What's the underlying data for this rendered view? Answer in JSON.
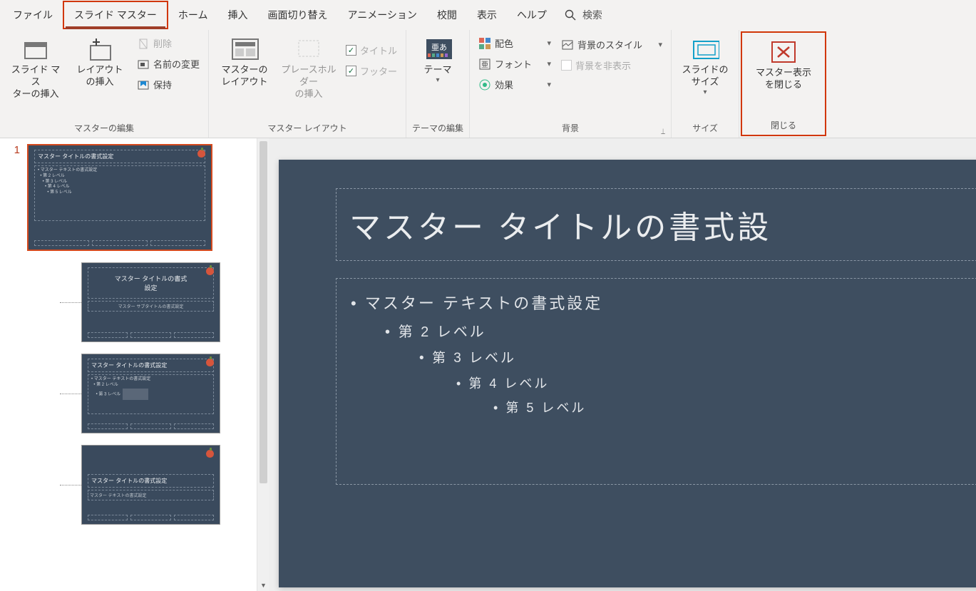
{
  "tabs": {
    "file": "ファイル",
    "slide_master": "スライド マスター",
    "home": "ホーム",
    "insert": "挿入",
    "transitions": "画面切り替え",
    "animations": "アニメーション",
    "review": "校閲",
    "view": "表示",
    "help": "ヘルプ",
    "search": "検索"
  },
  "ribbon": {
    "master_edit": {
      "insert_slide_master": "スライド マス\nターの挿入",
      "insert_layout": "レイアウト\nの挿入",
      "delete": "削除",
      "rename": "名前の変更",
      "preserve": "保持",
      "group_label": "マスターの編集"
    },
    "master_layout": {
      "master_layout": "マスターの\nレイアウト",
      "insert_placeholder": "プレースホルダー\nの挿入",
      "title_cb": "タイトル",
      "footer_cb": "フッター",
      "group_label": "マスター レイアウト"
    },
    "theme_edit": {
      "themes": "テーマ",
      "group_label": "テーマの編集"
    },
    "background": {
      "colors": "配色",
      "fonts": "フォント",
      "effects": "効果",
      "bg_styles": "背景のスタイル",
      "hide_bg": "背景を非表示",
      "group_label": "背景"
    },
    "size": {
      "slide_size": "スライドの\nサイズ",
      "group_label": "サイズ"
    },
    "close": {
      "close_master": "マスター表示\nを閉じる",
      "group_label": "閉じる"
    }
  },
  "sidebar": {
    "slide_number": "1",
    "master_thumb": {
      "title": "マスター タイトルの書式設定",
      "body_l1": "マスター テキストの書式設定",
      "body_l2": "第 2 レベル",
      "body_l3": "第 3 レベル",
      "body_l4": "第 4 レベル",
      "body_l5": "第 5 レベル"
    },
    "layout1": {
      "title": "マスター タイトルの書式\n設定",
      "subtitle": "マスター サブタイトルの書式設定"
    },
    "layout2": {
      "title": "マスター タイトルの書式設定",
      "body": "マスター テキストの書式設定"
    },
    "layout3": {
      "title": "マスター タイトルの書式設定",
      "body": "マスター テキストの書式設定"
    }
  },
  "slide": {
    "title": "マスター タイトルの書式設",
    "body": {
      "l1": "マスター テキストの書式設定",
      "l2": "第 2 レベル",
      "l3": "第 3 レベル",
      "l4": "第 4 レベル",
      "l5": "第 5 レベル"
    }
  }
}
